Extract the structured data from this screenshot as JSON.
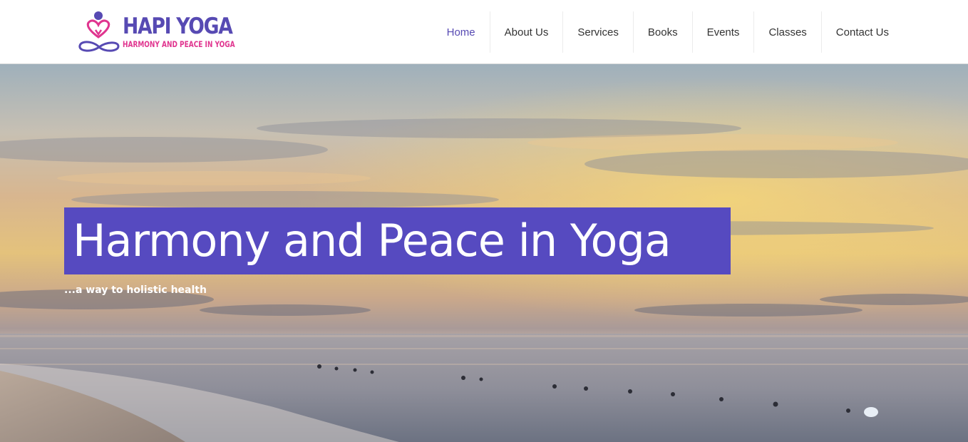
{
  "brand": {
    "title": "HAPI YOGA",
    "tagline": "HARMONY AND PEACE IN YOGA",
    "title_color": "#574ab3",
    "tagline_color": "#e0358f",
    "logo_icon": "meditating-heart-infinity-icon"
  },
  "nav": {
    "items": [
      {
        "label": "Home",
        "active": true
      },
      {
        "label": "About Us",
        "active": false
      },
      {
        "label": "Services",
        "active": false
      },
      {
        "label": "Books",
        "active": false
      },
      {
        "label": "Events",
        "active": false
      },
      {
        "label": "Classes",
        "active": false
      },
      {
        "label": "Contact Us",
        "active": false
      }
    ],
    "active_color": "#574ab3"
  },
  "hero": {
    "title": "Harmony and Peace in Yoga",
    "subtitle": "...a way to holistic health",
    "title_bg_color": "#564ac0",
    "image": "sunset-over-ocean-beach-photo"
  }
}
